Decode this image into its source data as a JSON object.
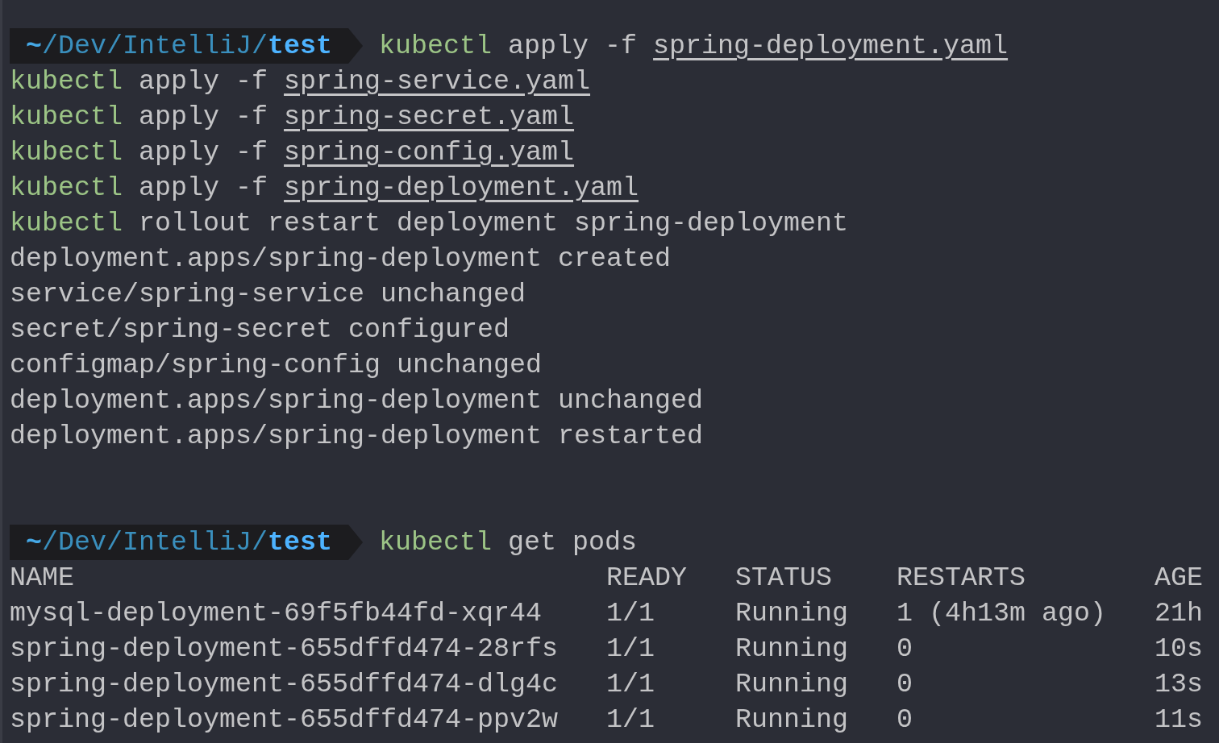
{
  "blocks": [
    {
      "prompt": {
        "home": "~",
        "path": "/Dev/IntelliJ/",
        "dir": "test"
      },
      "commands": [
        [
          {
            "kind": "cmd",
            "text": "kubectl"
          },
          {
            "kind": "arg",
            "text": "apply -f"
          },
          {
            "kind": "file",
            "text": "spring-deployment.yaml"
          }
        ],
        [
          {
            "kind": "cmd",
            "text": "kubectl"
          },
          {
            "kind": "arg",
            "text": "apply -f"
          },
          {
            "kind": "file",
            "text": "spring-service.yaml"
          }
        ],
        [
          {
            "kind": "cmd",
            "text": "kubectl"
          },
          {
            "kind": "arg",
            "text": "apply -f"
          },
          {
            "kind": "file",
            "text": "spring-secret.yaml"
          }
        ],
        [
          {
            "kind": "cmd",
            "text": "kubectl"
          },
          {
            "kind": "arg",
            "text": "apply -f"
          },
          {
            "kind": "file",
            "text": "spring-config.yaml"
          }
        ],
        [
          {
            "kind": "cmd",
            "text": "kubectl"
          },
          {
            "kind": "arg",
            "text": "apply -f"
          },
          {
            "kind": "file",
            "text": "spring-deployment.yaml"
          }
        ],
        [
          {
            "kind": "cmd",
            "text": "kubectl"
          },
          {
            "kind": "arg",
            "text": "rollout restart deployment spring-deployment"
          }
        ]
      ],
      "output": [
        "deployment.apps/spring-deployment created",
        "service/spring-service unchanged",
        "secret/spring-secret configured",
        "configmap/spring-config unchanged",
        "deployment.apps/spring-deployment unchanged",
        "deployment.apps/spring-deployment restarted"
      ]
    },
    {
      "prompt": {
        "home": "~",
        "path": "/Dev/IntelliJ/",
        "dir": "test"
      },
      "commands": [
        [
          {
            "kind": "cmd",
            "text": "kubectl"
          },
          {
            "kind": "arg",
            "text": "get pods"
          }
        ]
      ],
      "table": {
        "columns": [
          "NAME",
          "READY",
          "STATUS",
          "RESTARTS",
          "AGE"
        ],
        "rows": [
          [
            "mysql-deployment-69f5fb44fd-xqr44",
            "1/1",
            "Running",
            "1 (4h13m ago)",
            "21h"
          ],
          [
            "spring-deployment-655dffd474-28rfs",
            "1/1",
            "Running",
            "0",
            "10s"
          ],
          [
            "spring-deployment-655dffd474-dlg4c",
            "1/1",
            "Running",
            "0",
            "13s"
          ],
          [
            "spring-deployment-655dffd474-ppv2w",
            "1/1",
            "Running",
            "0",
            "11s"
          ]
        ]
      }
    }
  ]
}
